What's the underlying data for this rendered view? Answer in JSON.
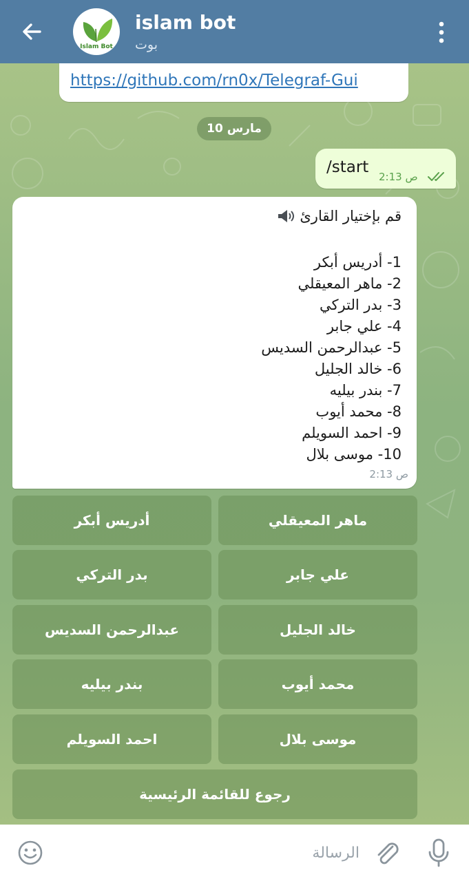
{
  "header": {
    "title": "islam bot",
    "subtitle": "بوت",
    "avatar_text": "Islam Bot"
  },
  "messages": {
    "link": "https://github.com/rn0x/Telegraf-Gui",
    "date_chip": "10 مارس",
    "outgoing": {
      "text": "/start",
      "time": "2:13 ص"
    },
    "incoming": {
      "heading": "قم بإختيار القارئ",
      "lines": [
        "1- أدريس أبكر",
        "2- ماهر المعيقلي",
        "3- بدر التركي",
        "4- علي جابر",
        "5- عبدالرحمن السديس",
        "6- خالد الجليل",
        "7- بندر بيليه",
        "8- محمد أيوب",
        "9- احمد السويلم",
        "10- موسى بلال"
      ],
      "time": "2:13 ص"
    }
  },
  "keyboard": {
    "buttons": [
      "ماهر المعيقلي",
      "أدريس أبكر",
      "علي جابر",
      "بدر التركي",
      "خالد الجليل",
      "عبدالرحمن السديس",
      "محمد أيوب",
      "بندر بيليه",
      "موسى بلال",
      "احمد السويلم"
    ],
    "back": "رجوع للقائمة الرئيسية"
  },
  "composer": {
    "placeholder": "الرسالة"
  },
  "colors": {
    "header": "#527da3",
    "outgoing_bubble": "#eefed9",
    "keyboard_button": "#6c9058",
    "link": "#2f76b9"
  },
  "icons": {
    "back": "arrow-left-icon",
    "menu": "more-vertical-icon",
    "ticks": "double-check-icon",
    "speaker": "speaker-icon",
    "emoji": "emoji-icon",
    "attach": "paperclip-icon",
    "mic": "microphone-icon"
  }
}
